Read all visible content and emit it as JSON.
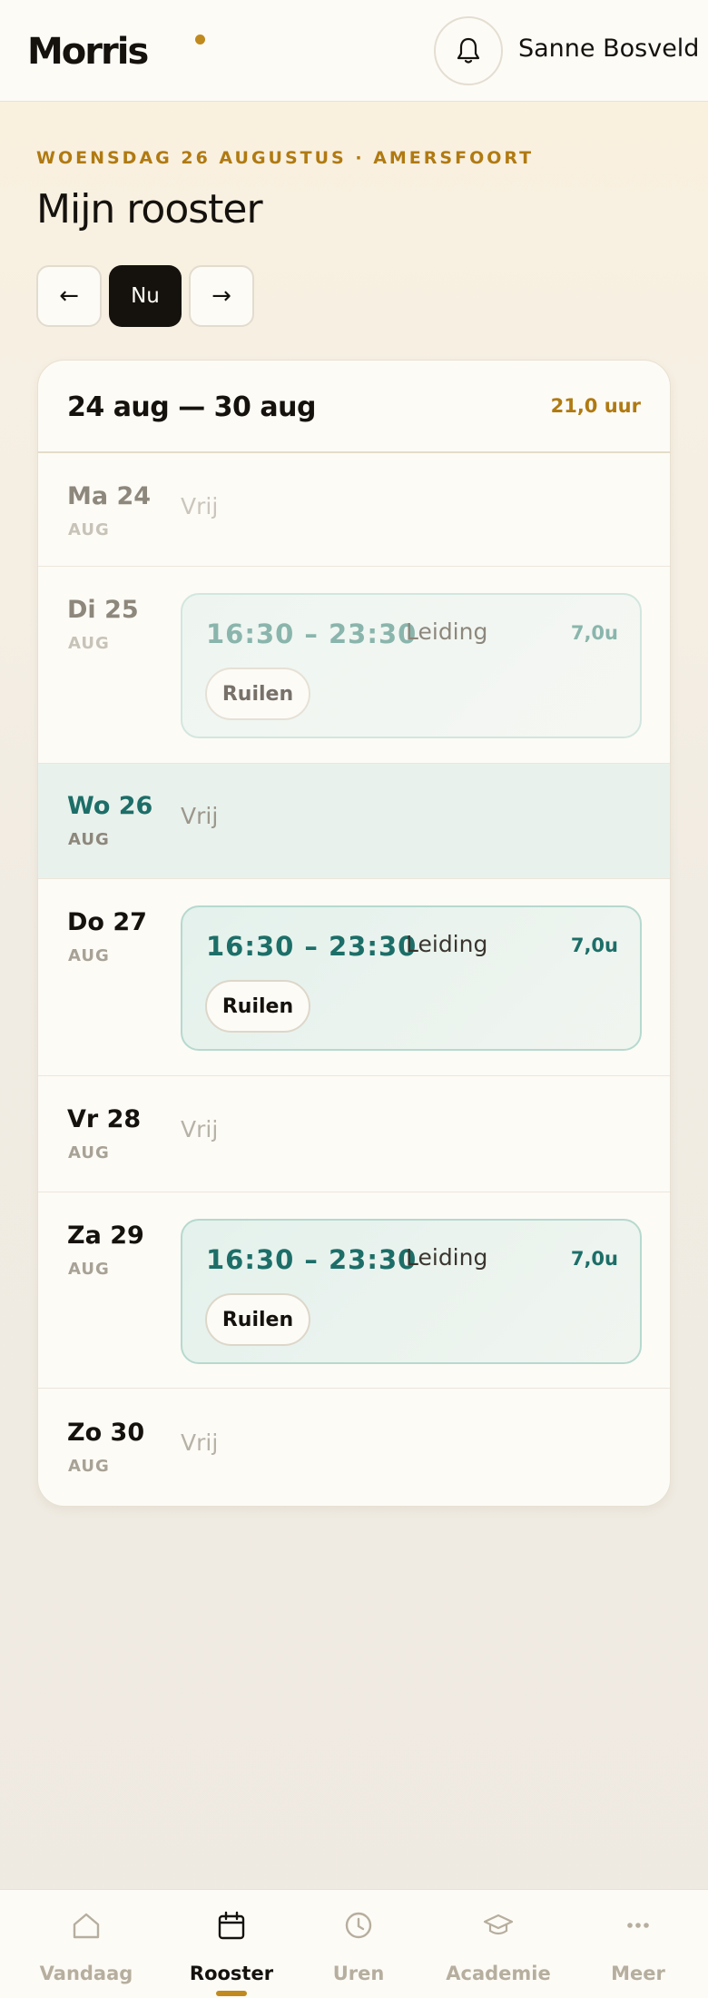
{
  "header": {
    "logo": "Morris",
    "user_name": "Sanne Bosveld",
    "bell_icon": "bell-icon"
  },
  "intro": {
    "eyebrow": "WOENSDAG 26 AUGUSTUS · AMERSFOORT",
    "title": "Mijn rooster",
    "prev_label": "←",
    "now_label": "Nu",
    "next_label": "→"
  },
  "week": {
    "range": "24 aug — 30 aug",
    "total": "21,0 uur",
    "days": [
      {
        "label": "Ma 24",
        "month": "AUG",
        "free": "Vrij"
      },
      {
        "label": "Di 25",
        "month": "AUG",
        "shift": {
          "time": "16:30 – 23:30",
          "role": "Leiding",
          "hours": "7,0u",
          "action": "Ruilen"
        }
      },
      {
        "label": "Wo 26",
        "month": "AUG",
        "free": "Vrij"
      },
      {
        "label": "Do 27",
        "month": "AUG",
        "shift": {
          "time": "16:30 – 23:30",
          "role": "Leiding",
          "hours": "7,0u",
          "action": "Ruilen"
        }
      },
      {
        "label": "Vr 28",
        "month": "AUG",
        "free": "Vrij"
      },
      {
        "label": "Za 29",
        "month": "AUG",
        "shift": {
          "time": "16:30 – 23:30",
          "role": "Leiding",
          "hours": "7,0u",
          "action": "Ruilen"
        }
      },
      {
        "label": "Zo 30",
        "month": "AUG",
        "free": "Vrij"
      }
    ]
  },
  "bottom_nav": {
    "tabs": [
      {
        "label": "Vandaag",
        "icon": "home-icon"
      },
      {
        "label": "Rooster",
        "icon": "calendar-icon"
      },
      {
        "label": "Uren",
        "icon": "clock-icon"
      },
      {
        "label": "Academie",
        "icon": "graduation-cap-icon"
      },
      {
        "label": "Meer",
        "icon": "more-dots-icon"
      }
    ]
  },
  "colors": {
    "accent": "#c08a1e",
    "teal": "#1d6e68",
    "ink": "#15120e"
  }
}
